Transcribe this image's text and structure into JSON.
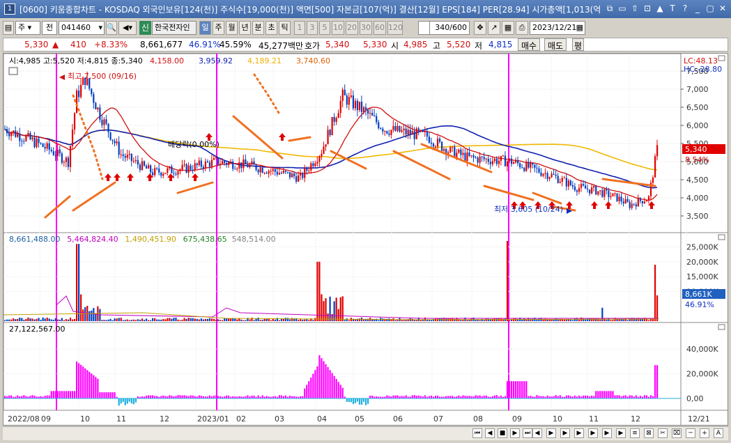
{
  "window": {
    "number": "1",
    "title": "[0600] 키움종합차트 - KOSDAQ 외국인보유[124(천)] 주식수[19,000(천)] 액면[500] 자본금[107(억)] 결산[12월] EPS[184] PER[28.94] 시가총액[1,013(억",
    "buttons": [
      "⧉",
      "▭",
      "⇧",
      "⊡",
      "▲",
      "T",
      "?",
      "_",
      "▢",
      "✕"
    ]
  },
  "toolbar": {
    "period_unit": "주",
    "jeon_label": "전",
    "code": "041460",
    "stock_name": "한국전자인",
    "shin_label": "신",
    "periods": [
      "일",
      "주",
      "월",
      "년",
      "분",
      "초",
      "틱"
    ],
    "active_period": "일",
    "intervals": [
      "1",
      "3",
      "5",
      "10",
      "20",
      "30",
      "60",
      "120"
    ],
    "count": "340/600",
    "date": "2023/12/21"
  },
  "quote": {
    "price": "5,330",
    "change": "410",
    "change_pct": "+8.33%",
    "volume": "8,661,677",
    "vol_ratio": "46.91%",
    "turnover": "45.59%",
    "amount": "45,277백만",
    "ask_label": "호가",
    "ask": "5,340",
    "bid": "5,330",
    "open_label": "시",
    "open": "4,985",
    "high_label": "고",
    "high": "5,520",
    "low_label": "저",
    "low": "4,815",
    "buy_label": "매수",
    "sell_label": "매도",
    "eval_label": "평"
  },
  "price_panel": {
    "header_ohlc": "시:4,985 고:5,520 저:4,815 종:5,340",
    "ma_values": [
      {
        "value": "4,158.00",
        "color": "#d01010"
      },
      {
        "value": "3,959.92",
        "color": "#1020b0"
      },
      {
        "value": "4,189.21",
        "color": "#f0b000"
      },
      {
        "value": "3,740.60",
        "color": "#e06000"
      }
    ],
    "lc": "LC:48.13",
    "hc": "HC:-28.80",
    "yticks": [
      "7,500",
      "7,000",
      "6,500",
      "6,000",
      "5,500",
      "5,000",
      "4,500",
      "4,000",
      "3,500"
    ],
    "current_tag": "5,340",
    "current_pct": "8.54%",
    "high_note": "최고 7,500 (09/16)",
    "low_note": "최저 3,605 (10/24)",
    "dividend_note": "배당락(0.00%)"
  },
  "volume_panel": {
    "values": [
      {
        "value": "8,661,488.00",
        "color": "#2060a0"
      },
      {
        "value": "5,464,824.40",
        "color": "#c000c0"
      },
      {
        "value": "1,490,451.90",
        "color": "#c0a000"
      },
      {
        "value": "675,438.65",
        "color": "#208020"
      },
      {
        "value": "548,514.00",
        "color": "#808080"
      }
    ],
    "yticks": [
      "25,000K",
      "20,000K",
      "15,000K",
      "10,000K"
    ],
    "current_tag": "8,661K",
    "current_pct": "46.91%"
  },
  "indicator_panel": {
    "value": "27,122,567.00",
    "yticks": [
      "40,000K",
      "20,000K",
      "0,00"
    ]
  },
  "xaxis": [
    "2022/08",
    "09",
    "10",
    "11",
    "12",
    "2023/01",
    "02",
    "03",
    "04",
    "05",
    "06",
    "07",
    "08",
    "09",
    "10",
    "11",
    "12",
    "12/21"
  ]
}
